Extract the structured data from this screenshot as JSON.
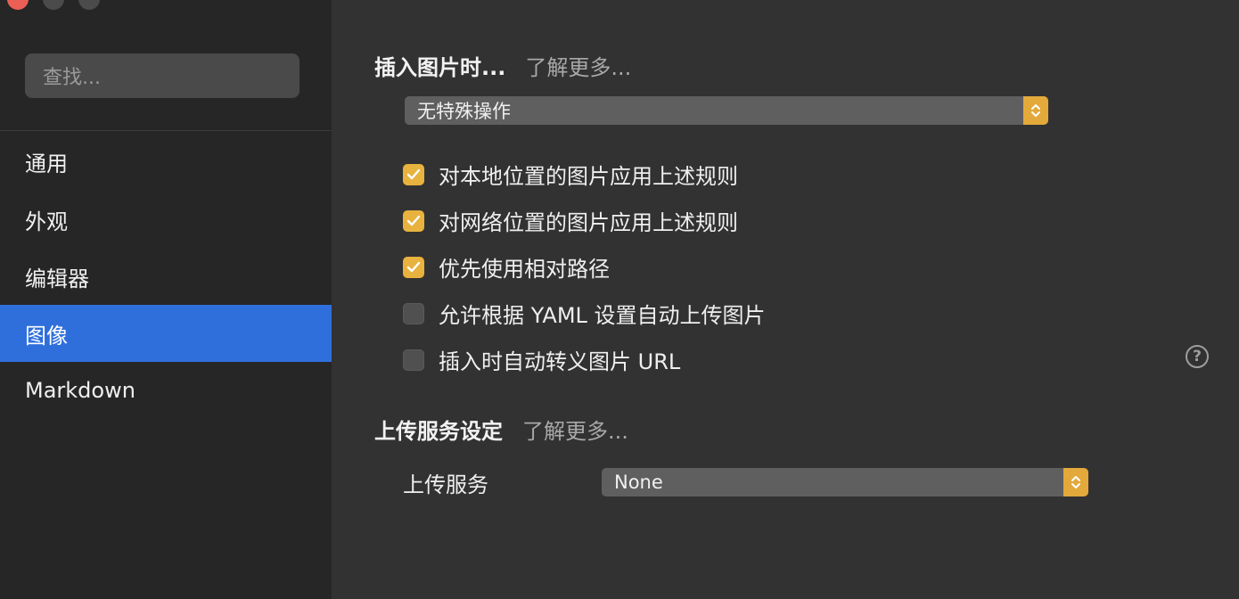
{
  "sidebar": {
    "search_placeholder": "查找...",
    "items": [
      {
        "label": "通用"
      },
      {
        "label": "外观"
      },
      {
        "label": "编辑器"
      },
      {
        "label": "图像",
        "active": true
      },
      {
        "label": "Markdown"
      }
    ]
  },
  "insert_image": {
    "heading": "插入图片时...",
    "learn_more": "了解更多...",
    "action_value": "无特殊操作",
    "options": [
      {
        "label": "对本地位置的图片应用上述规则",
        "checked": true
      },
      {
        "label": "对网络位置的图片应用上述规则",
        "checked": true
      },
      {
        "label": "优先使用相对路径",
        "checked": true
      },
      {
        "label": "允许根据 YAML 设置自动上传图片",
        "checked": false
      },
      {
        "label": "插入时自动转义图片 URL",
        "checked": false
      }
    ]
  },
  "upload": {
    "heading": "上传服务设定",
    "learn_more": "了解更多...",
    "service_label": "上传服务",
    "service_value": "None"
  },
  "help": {
    "glyph": "?"
  },
  "colors": {
    "accent_blue": "#2f6fdc",
    "checkbox_on": "#e8b23e",
    "close_button": "#ec5f57"
  }
}
